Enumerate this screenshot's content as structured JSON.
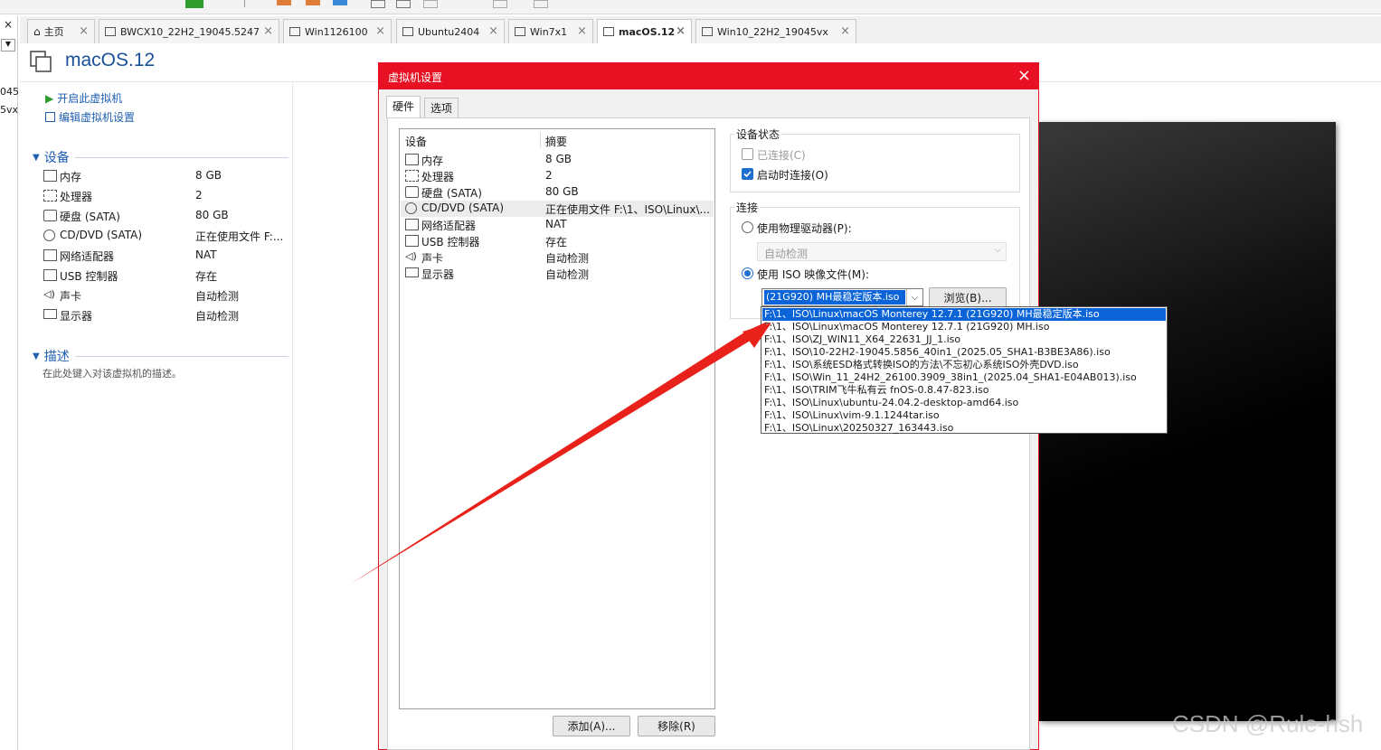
{
  "tabs": [
    {
      "label": "主页",
      "icon": "home-icon"
    },
    {
      "label": "BWCX10_22H2_19045.5247",
      "icon": "vm-icon"
    },
    {
      "label": "Win1126100",
      "icon": "vm-icon"
    },
    {
      "label": "Ubuntu2404",
      "icon": "vm-icon"
    },
    {
      "label": "Win7x1",
      "icon": "vm-icon"
    },
    {
      "label": "macOS.12",
      "icon": "vm-icon",
      "active": true
    },
    {
      "label": "Win10_22H2_19045vx",
      "icon": "vm-icon"
    }
  ],
  "left_stub": {
    "close": "×",
    "lines": [
      "045",
      "5vx"
    ]
  },
  "vm": {
    "title": "macOS.12",
    "actions": {
      "power_on": "开启此虚拟机",
      "edit_settings": "编辑虚拟机设置"
    },
    "devices_heading": "设备",
    "devices": [
      {
        "name": "内存",
        "value": "8 GB",
        "icon": "memory-icon"
      },
      {
        "name": "处理器",
        "value": "2",
        "icon": "cpu-icon"
      },
      {
        "name": "硬盘 (SATA)",
        "value": "80 GB",
        "icon": "disk-icon"
      },
      {
        "name": "CD/DVD (SATA)",
        "value": "正在使用文件 F:...",
        "icon": "cd-icon"
      },
      {
        "name": "网络适配器",
        "value": "NAT",
        "icon": "network-icon"
      },
      {
        "name": "USB 控制器",
        "value": "存在",
        "icon": "usb-icon"
      },
      {
        "name": "声卡",
        "value": "自动检测",
        "icon": "sound-icon"
      },
      {
        "name": "显示器",
        "value": "自动检测",
        "icon": "display-icon"
      }
    ],
    "description_heading": "描述",
    "description_placeholder": "在此处键入对该虚拟机的描述。"
  },
  "dialog": {
    "title": "虚拟机设置",
    "close": "×",
    "tabs": [
      "硬件",
      "选项"
    ],
    "list_headers": {
      "device": "设备",
      "summary": "摘要"
    },
    "hardware": [
      {
        "name": "内存",
        "summary": "8 GB",
        "icon": "memory-icon"
      },
      {
        "name": "处理器",
        "summary": "2",
        "icon": "cpu-icon"
      },
      {
        "name": "硬盘 (SATA)",
        "summary": "80 GB",
        "icon": "disk-icon"
      },
      {
        "name": "CD/DVD (SATA)",
        "summary": "正在使用文件 F:\\1、ISO\\Linux\\...",
        "icon": "cd-icon",
        "selected": true
      },
      {
        "name": "网络适配器",
        "summary": "NAT",
        "icon": "network-icon"
      },
      {
        "name": "USB 控制器",
        "summary": "存在",
        "icon": "usb-icon"
      },
      {
        "name": "声卡",
        "summary": "自动检测",
        "icon": "sound-icon"
      },
      {
        "name": "显示器",
        "summary": "自动检测",
        "icon": "display-icon"
      }
    ],
    "add_button": "添加(A)...",
    "remove_button": "移除(R)",
    "device_status": {
      "heading": "设备状态",
      "connected": {
        "label": "已连接(C)",
        "checked": false
      },
      "connect_at_power_on": {
        "label": "启动时连接(O)",
        "checked": true
      }
    },
    "connection": {
      "heading": "连接",
      "physical_drive": {
        "label": "使用物理驱动器(P):",
        "selected": false,
        "value": "自动检测"
      },
      "iso_image": {
        "label": "使用 ISO 映像文件(M):",
        "selected": true,
        "value": "(21G920) MH最稳定版本.iso"
      },
      "browse_button": "浏览(B)..."
    },
    "iso_history": [
      "F:\\1、ISO\\Linux\\macOS Monterey 12.7.1 (21G920) MH最稳定版本.iso",
      "F:\\1、ISO\\Linux\\macOS Monterey 12.7.1 (21G920) MH.iso",
      "F:\\1、ISO\\ZJ_WIN11_X64_22631_JJ_1.iso",
      "F:\\1、ISO\\10-22H2-19045.5856_40in1_(2025.05_SHA1-B3BE3A86).iso",
      "F:\\1、ISO\\系统ESD格式转换ISO的方法\\不忘初心系统ISO外壳DVD.iso",
      "F:\\1、ISO\\Win_11_24H2_26100.3909_38in1_(2025.04_SHA1-E04AB013).iso",
      "F:\\1、ISO\\TRIM飞牛私有云 fnOS-0.8.47-823.iso",
      "F:\\1、ISO\\Linux\\ubuntu-24.04.2-desktop-amd64.iso",
      "F:\\1、ISO\\Linux\\vim-9.1.1244tar.iso",
      "F:\\1、ISO\\Linux\\20250327_163443.iso"
    ],
    "iso_history_selected_index": 0
  },
  "watermark": "CSDN @Rule-hsh",
  "colors": {
    "accent": "#1f5fb0",
    "dialog_title": "#e81123",
    "selection": "#0a64d8",
    "annotation_arrow": "#e8221b"
  }
}
